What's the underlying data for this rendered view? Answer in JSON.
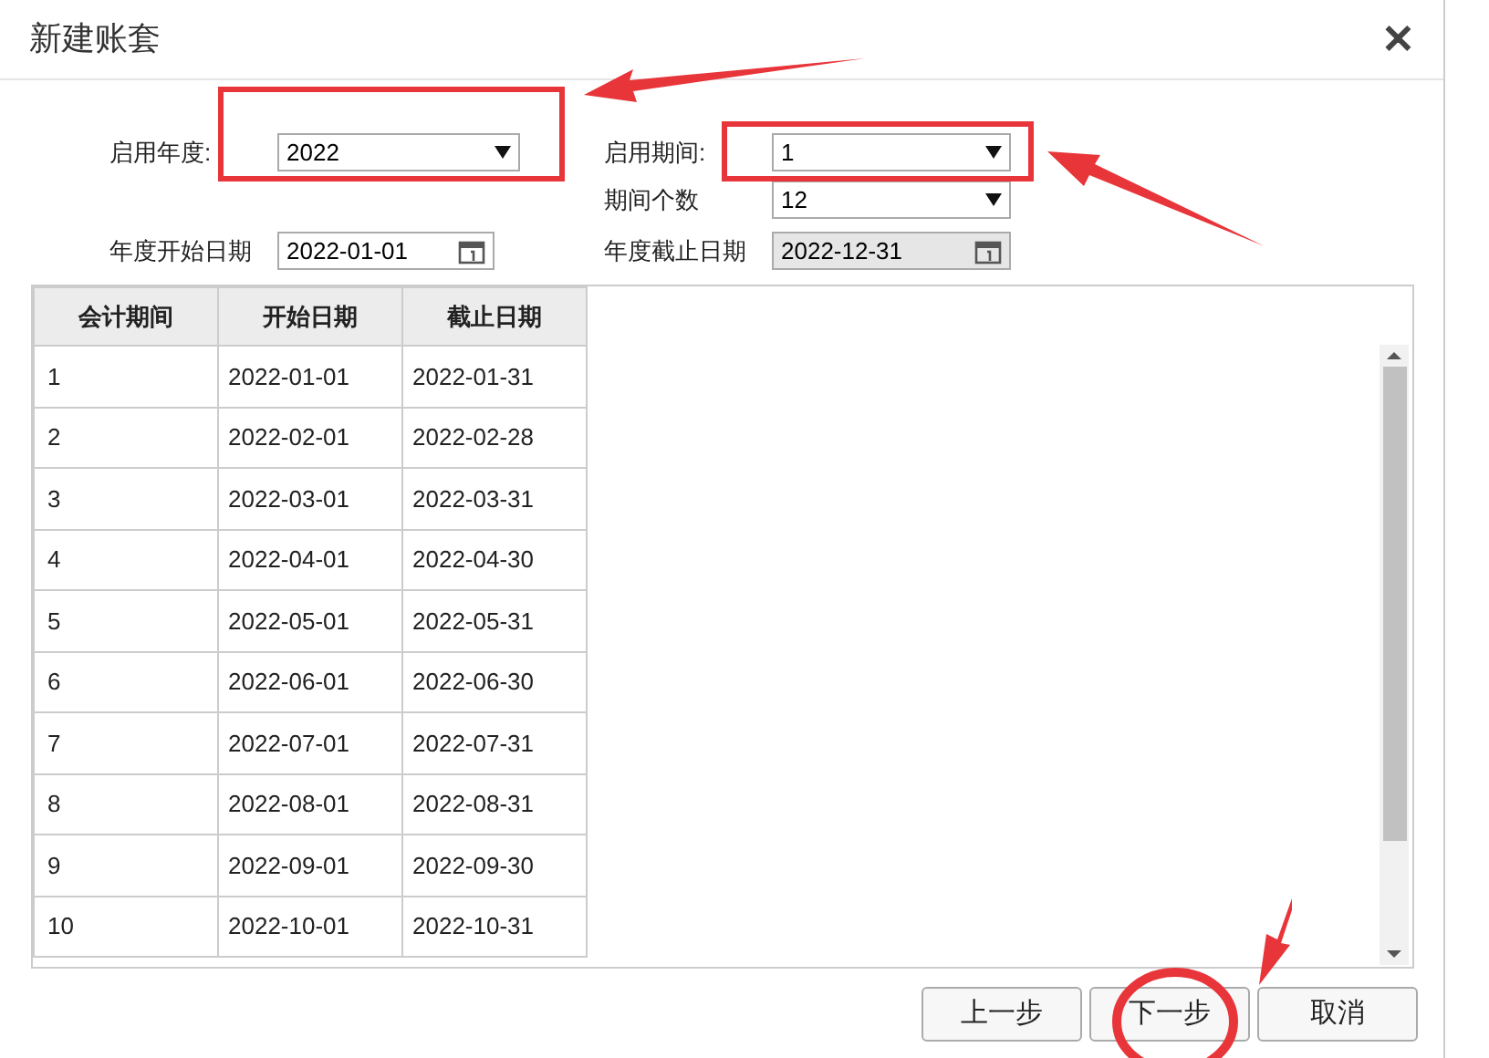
{
  "dialog": {
    "title": "新建账套",
    "close": "✕"
  },
  "form": [
    {
      "label": "启用年度:",
      "value": "2022",
      "kind": "select",
      "disabled": false
    },
    {
      "label": "启用期间:",
      "value": "1",
      "kind": "select",
      "disabled": false
    },
    {
      "label": "期间个数",
      "value": "12",
      "kind": "select",
      "disabled": false
    },
    {
      "label": "年度开始日期",
      "value": "2022-01-01",
      "kind": "date",
      "disabled": false
    },
    {
      "label": "年度截止日期",
      "value": "2022-12-31",
      "kind": "date",
      "disabled": true
    }
  ],
  "table": {
    "columns": [
      "会计期间",
      "开始日期",
      "截止日期"
    ],
    "rows": [
      [
        "1",
        "2022-01-01",
        "2022-01-31"
      ],
      [
        "2",
        "2022-02-01",
        "2022-02-28"
      ],
      [
        "3",
        "2022-03-01",
        "2022-03-31"
      ],
      [
        "4",
        "2022-04-01",
        "2022-04-30"
      ],
      [
        "5",
        "2022-05-01",
        "2022-05-31"
      ],
      [
        "6",
        "2022-06-01",
        "2022-06-30"
      ],
      [
        "7",
        "2022-07-01",
        "2022-07-31"
      ],
      [
        "8",
        "2022-08-01",
        "2022-08-31"
      ],
      [
        "9",
        "2022-09-01",
        "2022-09-30"
      ],
      [
        "10",
        "2022-10-01",
        "2022-10-31"
      ]
    ]
  },
  "buttons": [
    "上一步",
    "下一步",
    "取消"
  ]
}
